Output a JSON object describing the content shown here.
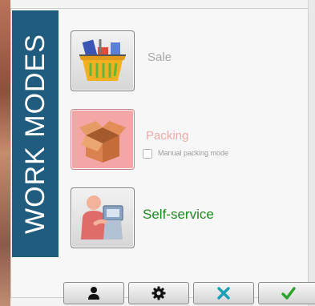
{
  "sidebar": {
    "title": "WORK MODES"
  },
  "modes": [
    {
      "id": "sale",
      "label": "Sale",
      "icon": "shopping-basket-icon",
      "enabled": true
    },
    {
      "id": "packing",
      "label": "Packing",
      "icon": "open-box-icon",
      "enabled": false,
      "option": {
        "label": "Manual packing mode",
        "checked": false
      }
    },
    {
      "id": "self-service",
      "label": "Self-service",
      "icon": "self-service-terminal-icon",
      "enabled": true,
      "selected": true
    }
  ],
  "toolbar": {
    "buttons": [
      {
        "id": "user",
        "icon": "user-icon"
      },
      {
        "id": "settings",
        "icon": "gear-icon"
      },
      {
        "id": "cancel",
        "icon": "close-icon"
      },
      {
        "id": "confirm",
        "icon": "checkmark-icon"
      }
    ]
  },
  "colors": {
    "sidebar": "#1f5c7e",
    "selected_label": "#1d8a1d",
    "disabled_tile": "#f4a5a5",
    "cancel": "#1a9fb3",
    "confirm": "#2aa22a"
  }
}
